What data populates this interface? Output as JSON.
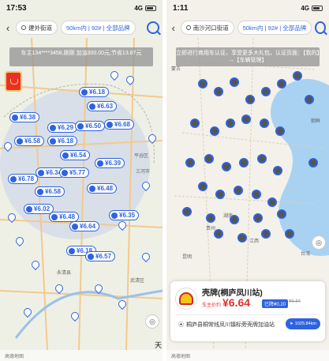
{
  "left": {
    "status": {
      "time": "17:53",
      "network": "4G"
    },
    "location": "建外街道",
    "filter": "50km内 | 92# | 全部品牌",
    "banner": "车主134****3458,刚刚 加油300.00元,节省13.87元",
    "price_labels": [
      "¥6.18",
      "¥6.63",
      "¥6.38",
      "¥6.29",
      "¥6.50",
      "¥6.68",
      "¥6.58",
      "¥6.18",
      "¥6.54",
      "¥6.39",
      "¥6.34",
      "¥5.77",
      "¥6.78",
      "¥6.58",
      "¥6.48",
      "¥6.02",
      "¥6.35",
      "¥6.48",
      "¥6.64",
      "¥6.18",
      "¥6.57"
    ],
    "city_labels": [
      "平谷区",
      "三河市",
      "永清县",
      "武清区",
      "天"
    ],
    "bottom_text": "高德地图"
  },
  "right": {
    "status": {
      "time": "1:11",
      "network": "4G"
    },
    "location": "南沙河口街道",
    "filter": "50km内 | 92# | 全部品牌",
    "banner": "立即进行商用车认证，享受更多大礼包，认证页面：【我的】→【车辆管理】",
    "city_labels": [
      "蒙古",
      "朝鲜",
      "湖南",
      "贵州",
      "江西",
      "台湾",
      "昆明"
    ],
    "bottom_text": "高德地图",
    "card": {
      "station_name": "壳牌(桐庐凤川站)",
      "price_label": "车主价约",
      "price": "¥6.64",
      "discount": "已降¥0.20",
      "original": "¥6.84",
      "address": "桐庐县桐常线凤川镇标旁壳牌加油站",
      "nav_label": "1025.84km"
    }
  },
  "colors": {
    "accent": "#2e63e0",
    "price_red": "#d33"
  }
}
